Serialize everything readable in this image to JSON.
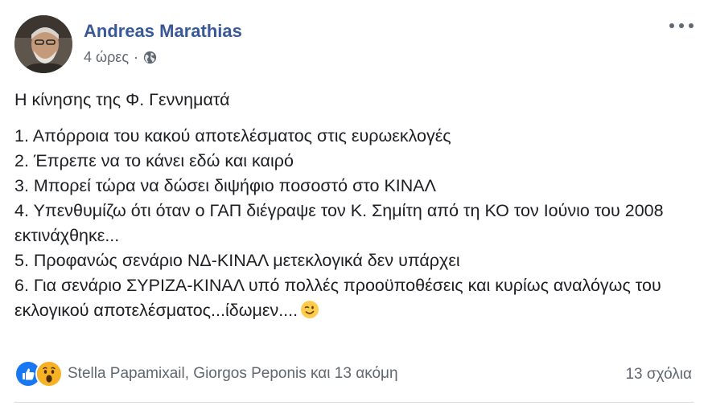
{
  "post": {
    "author": "Andreas Marathias",
    "time": "4 ώρες",
    "separator": "·",
    "privacy_icon": "globe-icon",
    "intro": "Η κίνησης της Φ. Γεννηματά",
    "lines": [
      "1. Απόρροια του κακού αποτελέσματος στις ευρωεκλογές",
      "2. Έπρεπε να το κάνει εδώ και καιρό",
      "3. Μπορεί τώρα να δώσει διψήφιο ποσοστό στο ΚΙΝΑΛ",
      "4. Υπενθυμίζω ότι όταν ο ΓΑΠ διέγραψε τον Κ. Σημίτη από τη ΚΟ τον Ιούνιο του 2008 εκτινάχθηκε...",
      "5. Προφανώς σενάριο ΝΔ-ΚΙΝΑΛ μετεκλογικά δεν υπάρχει",
      "6. Για σενάριο ΣΥΡΙΖΑ-ΚΙΝΑΛ υπό πολλές προοϋποθέσεις και κυρίως αναλόγως του εκλογικού αποτελέσματος...ίδωμεν...."
    ],
    "emoji_icon": "wink-emoji-icon"
  },
  "reactions": {
    "icons": [
      "like-icon",
      "wow-icon"
    ],
    "names": "Stella Papamixail, Giorgos Peponis και 13 ακόμη"
  },
  "comments": "13 σχόλια",
  "colors": {
    "author": "#385898",
    "meta": "#616770",
    "like_blue": "#1877f2",
    "wow_yellow": "#f7b125"
  }
}
